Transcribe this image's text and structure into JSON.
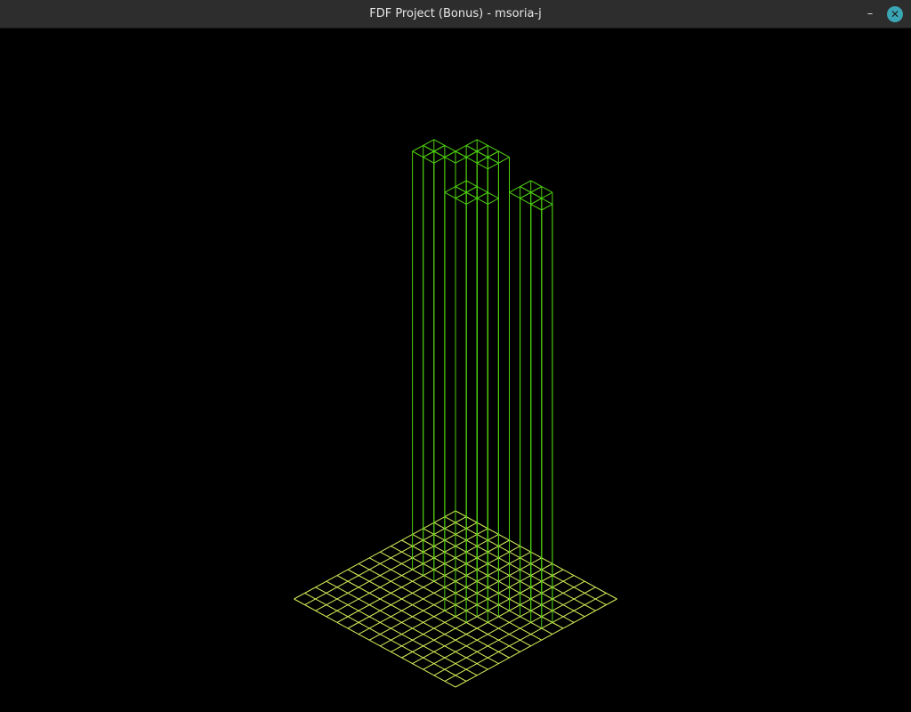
{
  "window": {
    "title": "FDF Project (Bonus) - msoria-j",
    "minimize_glyph": "–",
    "close_glyph": "✕"
  },
  "viewport": {
    "background": "#000000",
    "colors": {
      "low": "#d6f25a",
      "high": "#4ed10e"
    },
    "map": {
      "base_grid": [
        15,
        15
      ],
      "towers": [
        {
          "cells": [
            [
              2,
              0
            ],
            [
              3,
              0
            ],
            [
              4,
              0
            ],
            [
              2,
              1
            ],
            [
              3,
              1
            ],
            [
              4,
              1
            ]
          ],
          "height": "tall"
        },
        {
          "cells": [
            [
              0,
              2
            ],
            [
              1,
              2
            ],
            [
              2,
              2
            ],
            [
              0,
              3
            ],
            [
              1,
              3
            ]
          ],
          "height": "tall"
        },
        {
          "cells": [
            [
              8,
              1
            ],
            [
              9,
              1
            ],
            [
              8,
              2
            ],
            [
              9,
              2
            ],
            [
              10,
              2
            ]
          ],
          "height": "tall"
        },
        {
          "cells": [
            [
              5,
              4
            ],
            [
              6,
              4
            ],
            [
              7,
              4
            ],
            [
              5,
              5
            ],
            [
              6,
              5
            ]
          ],
          "height": "tall"
        }
      ]
    }
  }
}
